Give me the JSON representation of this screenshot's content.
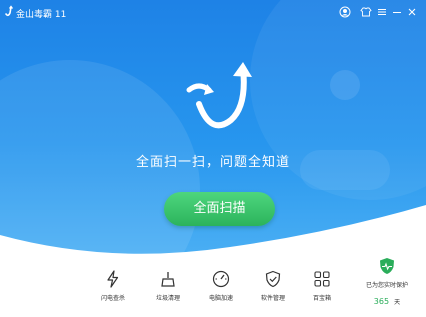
{
  "window": {
    "title": "金山毒霸 11",
    "controls": [
      "avatar-icon",
      "shirt-icon",
      "menu-icon",
      "minimize-icon",
      "close-icon"
    ]
  },
  "main": {
    "headline": "全面扫一扫，问题全知道",
    "scan_button": "全面扫描"
  },
  "toolbar": {
    "items": [
      {
        "label": "闪电查杀",
        "icon": "lightning-icon"
      },
      {
        "label": "垃圾清理",
        "icon": "broom-icon"
      },
      {
        "label": "电脑加速",
        "icon": "speedometer-icon"
      },
      {
        "label": "软件管理",
        "icon": "shield-check-icon"
      },
      {
        "label": "百宝箱",
        "icon": "grid-icon"
      }
    ],
    "protection": {
      "label": "已为您实时保护",
      "days": "365",
      "unit": "天",
      "icon": "shield-heartbeat-icon"
    }
  },
  "colors": {
    "hero_blue": "#1e82e6",
    "scan_green": "#2cb35c",
    "protect_green": "#2aad5a"
  }
}
